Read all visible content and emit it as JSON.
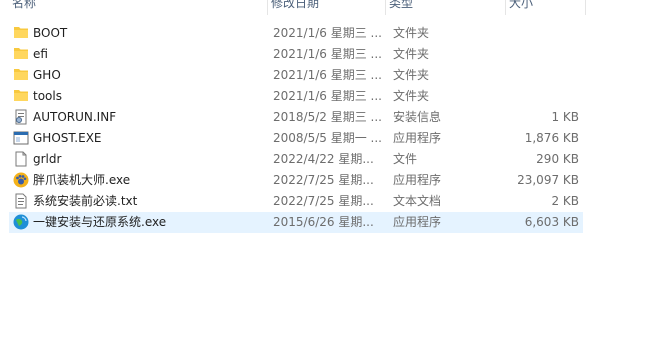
{
  "columns": {
    "name": "名称",
    "date": "修改日期",
    "type": "类型",
    "size": "大小"
  },
  "files": [
    {
      "name": "BOOT",
      "date": "2021/1/6 星期三 ...",
      "type": "文件夹",
      "size": "",
      "icon": "folder-icon"
    },
    {
      "name": "efi",
      "date": "2021/1/6 星期三 ...",
      "type": "文件夹",
      "size": "",
      "icon": "folder-icon"
    },
    {
      "name": "GHO",
      "date": "2021/1/6 星期三 ...",
      "type": "文件夹",
      "size": "",
      "icon": "folder-icon"
    },
    {
      "name": "tools",
      "date": "2021/1/6 星期三 ...",
      "type": "文件夹",
      "size": "",
      "icon": "folder-icon"
    },
    {
      "name": "AUTORUN.INF",
      "date": "2018/5/2 星期三 ...",
      "type": "安装信息",
      "size": "1 KB",
      "icon": "setup-info-icon"
    },
    {
      "name": "GHOST.EXE",
      "date": "2008/5/5 星期一 ...",
      "type": "应用程序",
      "size": "1,876 KB",
      "icon": "exe-window-icon"
    },
    {
      "name": "grldr",
      "date": "2022/4/22 星期...",
      "type": "文件",
      "size": "290 KB",
      "icon": "file-icon"
    },
    {
      "name": "胖爪装机大师.exe",
      "date": "2022/7/25 星期...",
      "type": "应用程序",
      "size": "23,097 KB",
      "icon": "paw-app-icon"
    },
    {
      "name": "系统安装前必读.txt",
      "date": "2022/7/25 星期...",
      "type": "文本文档",
      "size": "2 KB",
      "icon": "text-file-icon"
    },
    {
      "name": "一键安装与还原系统.exe",
      "date": "2015/6/26 星期...",
      "type": "应用程序",
      "size": "6,603 KB",
      "icon": "globe-app-icon",
      "selected": true
    }
  ],
  "colors": {
    "folder": "#f8c93f",
    "selection": "#e5f3ff",
    "header_text": "#4c607a",
    "secondary_text": "#6d6d6d"
  }
}
